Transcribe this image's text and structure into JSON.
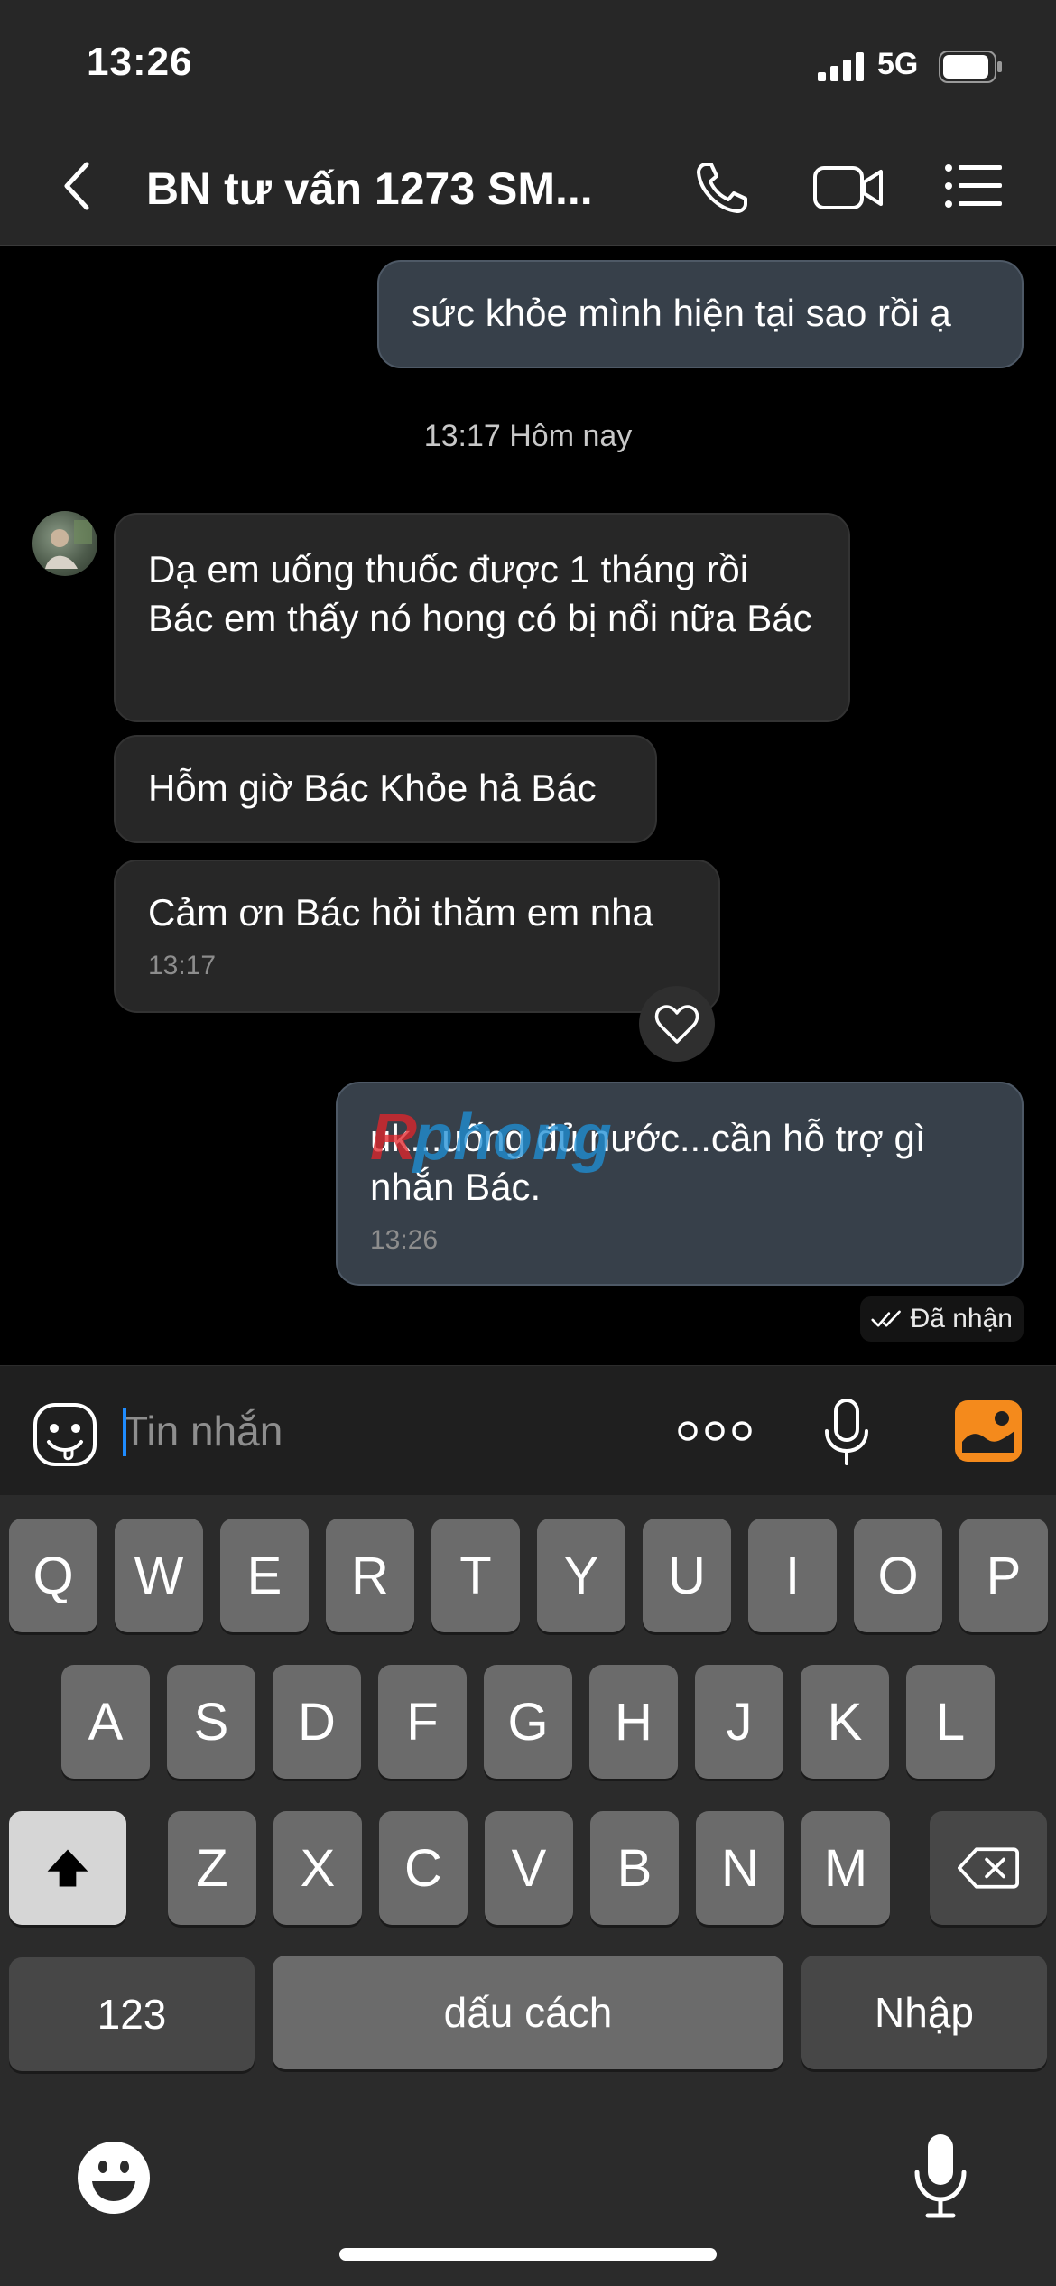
{
  "status_bar": {
    "time": "13:26",
    "network": "5G"
  },
  "header": {
    "title": "BN tư vấn 1273 SM..."
  },
  "messages": [
    {
      "id": "m1",
      "direction": "outgoing",
      "text": "sức khỏe mình hiện tại sao rồi ạ"
    },
    {
      "id": "m2",
      "direction": "incoming",
      "text": "Dạ em uống thuốc được 1 tháng rồi Bác em  thấy nó hong có bị nổi  nữa Bác"
    },
    {
      "id": "m3",
      "direction": "incoming",
      "text": "Hỗm giờ Bác Khỏe hả Bác"
    },
    {
      "id": "m4",
      "direction": "incoming",
      "text": "Cảm ơn Bác hỏi thăm em nha",
      "time": "13:17"
    },
    {
      "id": "m5",
      "direction": "outgoing",
      "text": "uk...uống đủ nước...cần hỗ trợ gì nhắn Bác.",
      "time": "13:26"
    }
  ],
  "date_separator": "13:17 Hôm nay",
  "delivery_status": "Đã nhận",
  "watermark": "Rphong",
  "input": {
    "placeholder": "Tin nhắn"
  },
  "keyboard": {
    "row1": [
      "Q",
      "W",
      "E",
      "R",
      "T",
      "Y",
      "U",
      "I",
      "O",
      "P"
    ],
    "row2": [
      "A",
      "S",
      "D",
      "F",
      "G",
      "H",
      "J",
      "K",
      "L"
    ],
    "row3": [
      "Z",
      "X",
      "C",
      "V",
      "B",
      "N",
      "M"
    ],
    "numbers_key": "123",
    "space_key": "dấu cách",
    "return_key": "Nhập"
  },
  "icons": {
    "back": "chevron-left-icon",
    "call": "phone-icon",
    "video": "video-camera-icon",
    "menu": "list-icon",
    "like": "heart-icon",
    "sticker": "sticker-icon",
    "more": "more-dots-icon",
    "mic": "microphone-icon",
    "image": "image-icon",
    "shift": "shift-icon",
    "backspace": "backspace-icon",
    "emoji": "emoji-icon"
  },
  "colors": {
    "outgoing_bubble": "#37404a",
    "incoming_bubble": "#272727",
    "image_button": "#f48a1c",
    "caret": "#1f8cff"
  }
}
